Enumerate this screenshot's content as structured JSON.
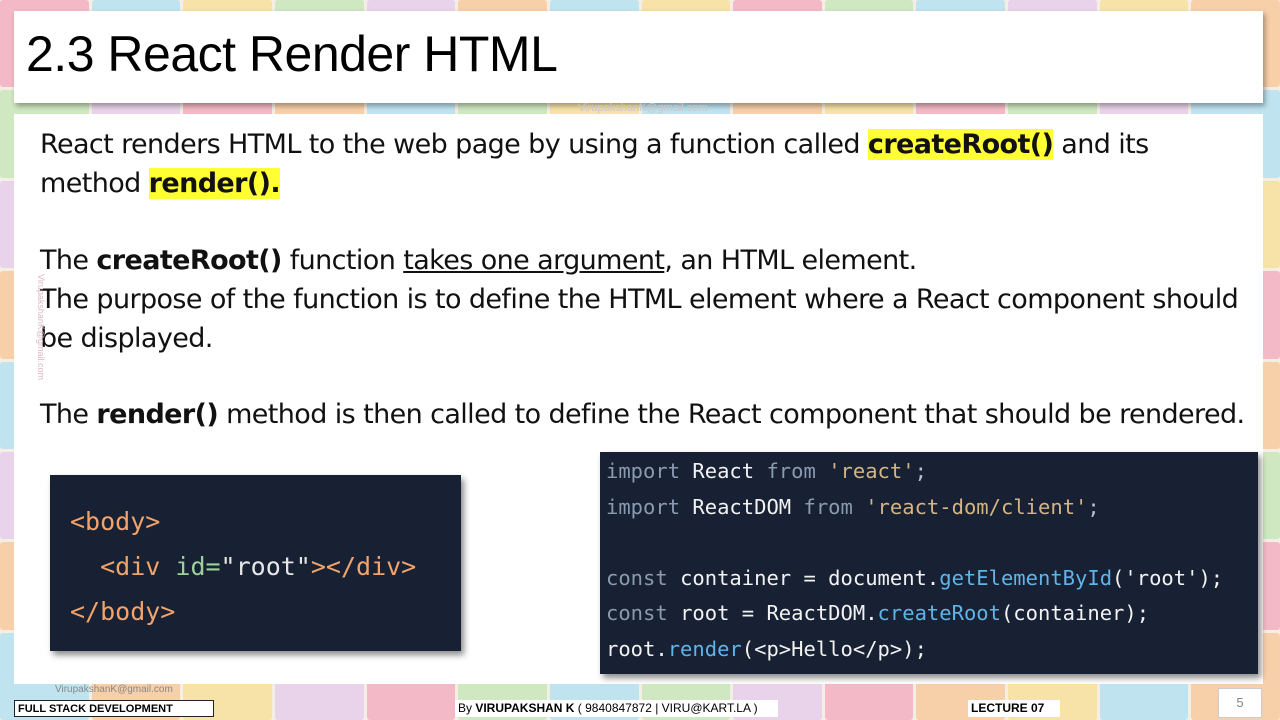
{
  "slide": {
    "title": "2.3 React Render HTML",
    "watermark": "VirupakshanK@gmail.com",
    "slide_number": "5"
  },
  "body": {
    "p1_a": "React renders HTML to the web page by using a function called ",
    "p1_hl1": "createRoot()",
    "p1_b": " and its method ",
    "p1_hl2": "render().",
    "p2_a": "The ",
    "p2_bold": "createRoot()",
    "p2_b": " function ",
    "p2_underline": "takes one argument",
    "p2_c": ", an HTML element.",
    "p3": "The purpose of the function is to define the HTML element where a React component should be displayed.",
    "p4_a": "The ",
    "p4_bold": "render()",
    "p4_b": " method is then called to define the React component that should be rendered."
  },
  "code_html": {
    "line1": "<body>",
    "line2_open": "<div",
    "line2_attr": "id=",
    "line2_val": "\"root\"",
    "line2_close": "></div>",
    "line3": "</body>"
  },
  "code_js": {
    "l1_kw": "import",
    "l1_id": "React",
    "l1_from": "from",
    "l1_str": "'react'",
    "l1_end": ";",
    "l2_kw": "import",
    "l2_id": "ReactDOM",
    "l2_from": "from",
    "l2_str": "'react-dom/client'",
    "l2_end": ";",
    "l3_kw": "const",
    "l3_id": "container = document.",
    "l3_fn": "getElementById",
    "l3_args": "('root');",
    "l4_kw": "const",
    "l4_id": "root = ReactDOM.",
    "l4_fn": "createRoot",
    "l4_args": "(container);",
    "l5_id": "root.",
    "l5_fn": "render",
    "l5_args": "(<p>Hello</p>);"
  },
  "footer": {
    "course": "FULL STACK DEVELOPMENT",
    "by_prefix": "By ",
    "by_name": "VIRUPAKSHAN K",
    "by_contact": " ( 9840847872 | VIRU@KART.LA )",
    "lecture": "LECTURE 07"
  }
}
